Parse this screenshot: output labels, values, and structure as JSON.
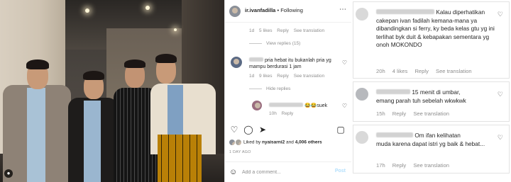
{
  "post": {
    "username": "ir.ivanfadilla",
    "separator": "•",
    "follow_status": "Following",
    "more_icon": "more-dots-icon",
    "likes_names": "nyaisarni2",
    "likes_and": "and",
    "likes_others": "4,006 others",
    "liked_by_label": "Liked by",
    "date": "1 DAY AGO",
    "add_comment_placeholder": "Add a comment...",
    "post_label": "Post"
  },
  "comments": [
    {
      "time": "1d",
      "likes": "5 likes",
      "reply": "Reply",
      "translate": "See translation",
      "view_replies": "View replies (15)"
    },
    {
      "text": "pria hebat itu bukanlah pria yg mampu berdurasi 1 jam",
      "time": "1d",
      "likes": "9 likes",
      "reply": "Reply",
      "translate": "See translation",
      "hide_replies": "Hide replies"
    },
    {
      "text": "😂😂suek",
      "time": "10h",
      "reply": "Reply"
    }
  ],
  "cards": [
    {
      "text_line1": "Kalau",
      "text_rest": "diperhatikan cakepan ivan fadilah kemana-mana ya dibandingkan si ferry, ky beda kelas gtu yg ini terlihat byk duit & kebapakan sementara yg onoh MOKONDO",
      "time": "20h",
      "likes": "4 likes",
      "reply": "Reply",
      "translate": "See translation"
    },
    {
      "text_line1": "15 menit di umbar,",
      "text_rest": "emang parah tuh sebelah wkwkwk",
      "time": "15h",
      "reply": "Reply",
      "translate": "See translation"
    },
    {
      "text_line1": "Om ifan kelihatan",
      "text_rest": "muda karena dapat istri yg baik & hebat...",
      "time": "17h",
      "reply": "Reply",
      "translate": "See translation"
    }
  ],
  "icons": {
    "heart": "heart-icon",
    "comment": "comment-icon",
    "share": "share-icon",
    "save": "bookmark-icon",
    "emoji": "emoji-icon",
    "tag": "tagged-people-icon"
  },
  "colors": {
    "link_blue_faded": "#b2dffc",
    "secondary_text": "#8e8e8e",
    "primary_text": "#262626"
  }
}
